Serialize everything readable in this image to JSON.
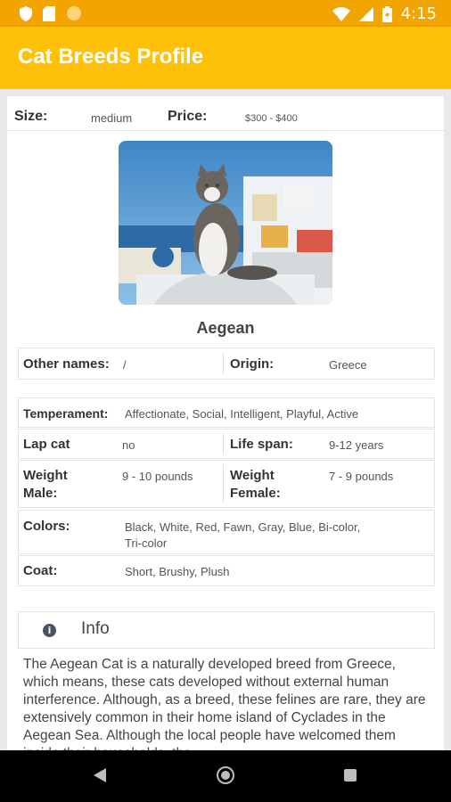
{
  "status_bar": {
    "time": "4:15",
    "colors": {
      "background": "#f2a400"
    }
  },
  "app_bar": {
    "title": "Cat Breeds Profile",
    "color": "#ffc107"
  },
  "summary": {
    "size_label": "Size:",
    "size_value": "medium",
    "price_label": "Price:",
    "price_value": "$300 - $400"
  },
  "breed": {
    "name": "Aegean",
    "photo_icon": "cat-photo"
  },
  "details": {
    "other_names_label": "Other names:",
    "other_names_value": "/",
    "origin_label": "Origin:",
    "origin_value": "Greece",
    "temperament_label": "Temperament:",
    "temperament_value": "Affectionate, Social, Intelligent, Playful, Active",
    "lapcat_label": "Lap cat",
    "lapcat_value": "no",
    "lifespan_label": "Life span:",
    "lifespan_value": "9-12 years",
    "weight_male_label_1": "Weight",
    "weight_male_label_2": "Male:",
    "weight_male_value": "9 - 10 pounds",
    "weight_female_label_1": "Weight",
    "weight_female_label_2": "Female:",
    "weight_female_value": "7 - 9 pounds",
    "colors_label": "Colors:",
    "colors_value_1": "Black, White, Red, Fawn, Gray, Blue, Bi-color,",
    "colors_value_2": "Tri-color",
    "coat_label": "Coat:",
    "coat_value": "Short, Brushy, Plush"
  },
  "info": {
    "icon": "info-icon",
    "title": "Info",
    "text": "The Aegean Cat is a naturally developed breed from Greece, which means, these cats developed without external human interference. Although, as a breed, these felines are rare, they are extensively common in their home island of Cyclades in the Aegean Sea. Although the local people have welcomed them inside their households, the"
  }
}
